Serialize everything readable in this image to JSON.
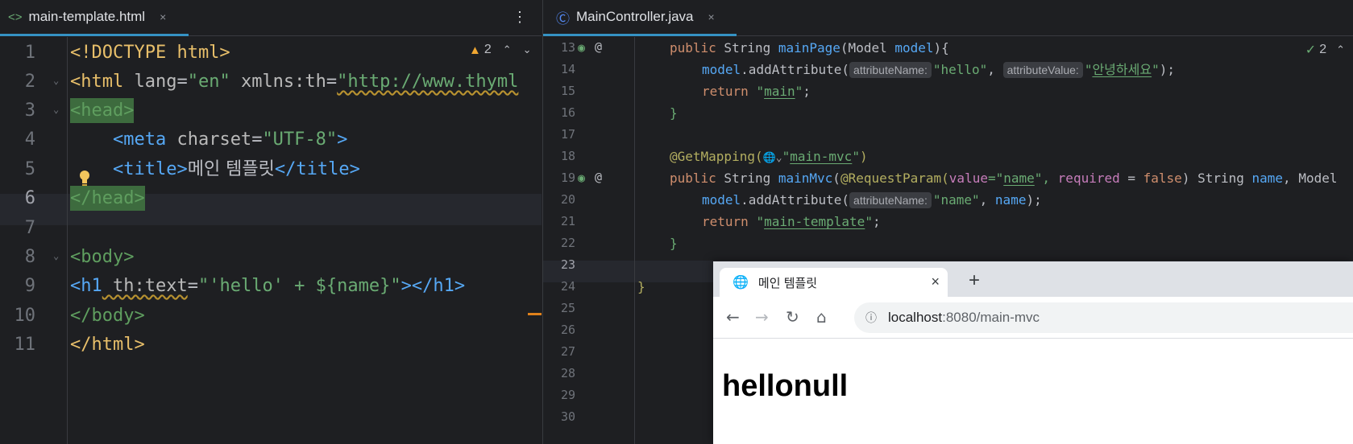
{
  "left_editor": {
    "tab": {
      "filename": "main-template.html",
      "icon": "html-file-icon",
      "close": "×"
    },
    "menu": "⋮",
    "inspection": {
      "warning_count": "2",
      "up": "^",
      "down": "v"
    },
    "line_numbers": [
      "1",
      "2",
      "3",
      "4",
      "5",
      "6",
      "7",
      "8",
      "9",
      "10",
      "11"
    ],
    "current_line": "6",
    "code": {
      "l1": "<!DOCTYPE html>",
      "l2_open": "<html",
      "l2_attr1": " lang",
      "l2_eq1": "=",
      "l2_val1": "\"en\"",
      "l2_attr2": " xmlns:th",
      "l2_eq2": "=",
      "l2_val2": "\"http://www.thyml",
      "l3": "<head>",
      "l4_indent": "    ",
      "l4_tag": "<meta",
      "l4_attr": " charset",
      "l4_eq": "=",
      "l4_val": "\"UTF-8\"",
      "l4_close": ">",
      "l5_indent": "    ",
      "l5_open": "<title>",
      "l5_text": "메인 템플릿",
      "l5_close": "</title>",
      "l6": "</head>",
      "l8": "<body>",
      "l9_open": "<h1",
      "l9_attr": " th:text",
      "l9_eq": "=",
      "l9_val": "\"'hello' + ${name}\"",
      "l9_close": "></h1>",
      "l10": "</body>",
      "l11": "</html>"
    }
  },
  "right_editor": {
    "tab": {
      "filename": "MainController.java",
      "icon": "java-class-icon",
      "close": "×"
    },
    "inspection": {
      "ok_count": "2",
      "up": "^"
    },
    "line_numbers": [
      "13",
      "14",
      "15",
      "16",
      "17",
      "18",
      "19",
      "20",
      "21",
      "22",
      "23",
      "24",
      "25",
      "26",
      "27",
      "28",
      "29",
      "30"
    ],
    "current_line": "23",
    "code": {
      "l13_a": "public",
      "l13_b": " String ",
      "l13_c": "mainPage",
      "l13_d": "(Model ",
      "l13_e": "model",
      "l13_f": "){",
      "l14_a": "model",
      "l14_b": ".addAttribute(",
      "l14_hint1": "attributeName:",
      "l14_s1": "\"hello\"",
      "l14_c": ", ",
      "l14_hint2": "attributeValue:",
      "l14_s2a": "\"",
      "l14_s2b": "안녕하세요",
      "l14_s2c": "\"",
      "l14_d": ");",
      "l15_a": "return ",
      "l15_b": "\"",
      "l15_c": "main",
      "l15_d": "\"",
      "l15_e": ";",
      "l16": "}",
      "l18_a": "@GetMapping(",
      "l18_b": "\"",
      "l18_c": "main-mvc",
      "l18_d": "\"",
      "l18_e": ")",
      "l19_a": "public",
      "l19_b": " String ",
      "l19_c": "mainMvc",
      "l19_d": "(",
      "l19_e": "@RequestParam(",
      "l19_f": "value",
      "l19_g": "=\"",
      "l19_h": "name",
      "l19_i": "\", ",
      "l19_j": "required",
      "l19_k": " = ",
      "l19_l": "false",
      "l19_m": ") String ",
      "l19_n": "name",
      "l19_o": ", Model",
      "l20_a": "model",
      "l20_b": ".addAttribute(",
      "l20_hint": "attributeName:",
      "l20_s": "\"name\"",
      "l20_c": ", ",
      "l20_d": "name",
      "l20_e": ");",
      "l21_a": "return ",
      "l21_b": "\"",
      "l21_c": "main-template",
      "l21_d": "\"",
      "l21_e": ";",
      "l22": "}",
      "l24": "}"
    }
  },
  "browser": {
    "tab_title": "메인 템플릿",
    "tab_close": "×",
    "new_tab": "+",
    "url_host": "localhost",
    "url_rest": ":8080/main-mvc",
    "page_heading": "hellonull"
  }
}
